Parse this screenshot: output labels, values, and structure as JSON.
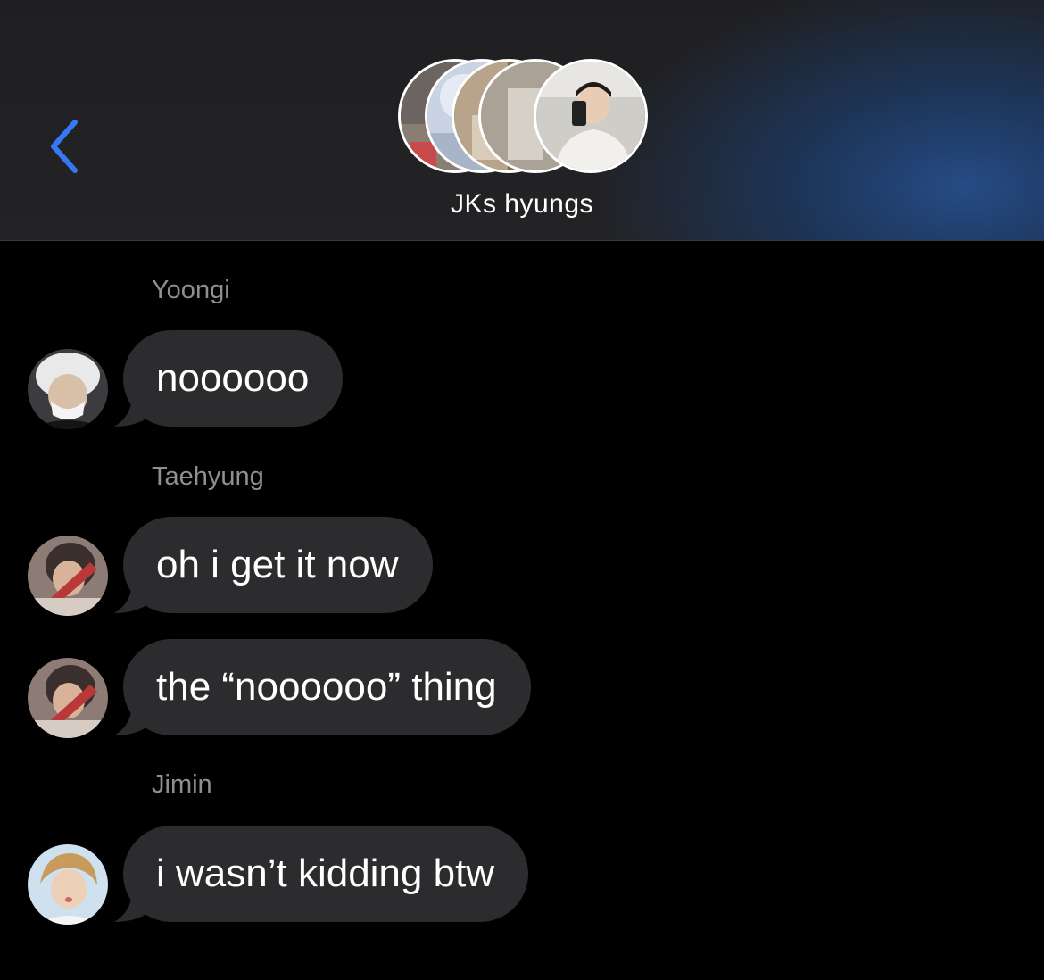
{
  "header": {
    "back_icon": "chevron-left-icon",
    "group_title": "JKs hyungs",
    "accent_color": "#3478f6",
    "avatars": [
      "group-member-avatar",
      "group-member-avatar",
      "group-member-avatar",
      "group-member-avatar",
      "group-member-avatar"
    ]
  },
  "messages": [
    {
      "sender": "Yoongi",
      "text": "noooooo"
    },
    {
      "sender": "Taehyung",
      "text": "oh i get it now"
    },
    {
      "sender": "",
      "text": "the “noooooo” thing"
    },
    {
      "sender": "Jimin",
      "text": "i wasn’t kidding btw"
    }
  ],
  "colors": {
    "background": "#000000",
    "header_background": "#202022",
    "bubble": "#2c2c2e",
    "sender_label": "#8e8e93",
    "text": "#ffffff"
  }
}
